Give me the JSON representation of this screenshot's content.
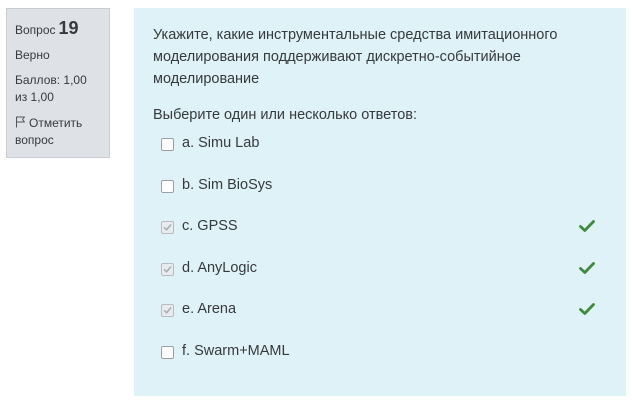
{
  "info": {
    "question_label": "Вопрос",
    "question_number": "19",
    "state": "Верно",
    "grade": "Баллов: 1,00 из 1,00",
    "flag_label": "Отметить вопрос"
  },
  "question": {
    "text": "Укажите, какие инструментальные средства имитационного моделирования поддерживают дискретно-событийное моделирование",
    "prompt": "Выберите один или несколько ответов:",
    "options": [
      {
        "label": "a. Simu Lab",
        "checked": false,
        "correct": false
      },
      {
        "label": "b. Sim BioSys",
        "checked": false,
        "correct": false
      },
      {
        "label": "c. GPSS",
        "checked": true,
        "correct": true
      },
      {
        "label": "d. AnyLogic",
        "checked": true,
        "correct": true
      },
      {
        "label": "e. Arena",
        "checked": true,
        "correct": true
      },
      {
        "label": "f. Swarm+MAML",
        "checked": false,
        "correct": false
      }
    ]
  },
  "colors": {
    "info_bg": "#dee2e6",
    "content_bg": "#def2f8",
    "correct_check": "#3d8b3d"
  }
}
